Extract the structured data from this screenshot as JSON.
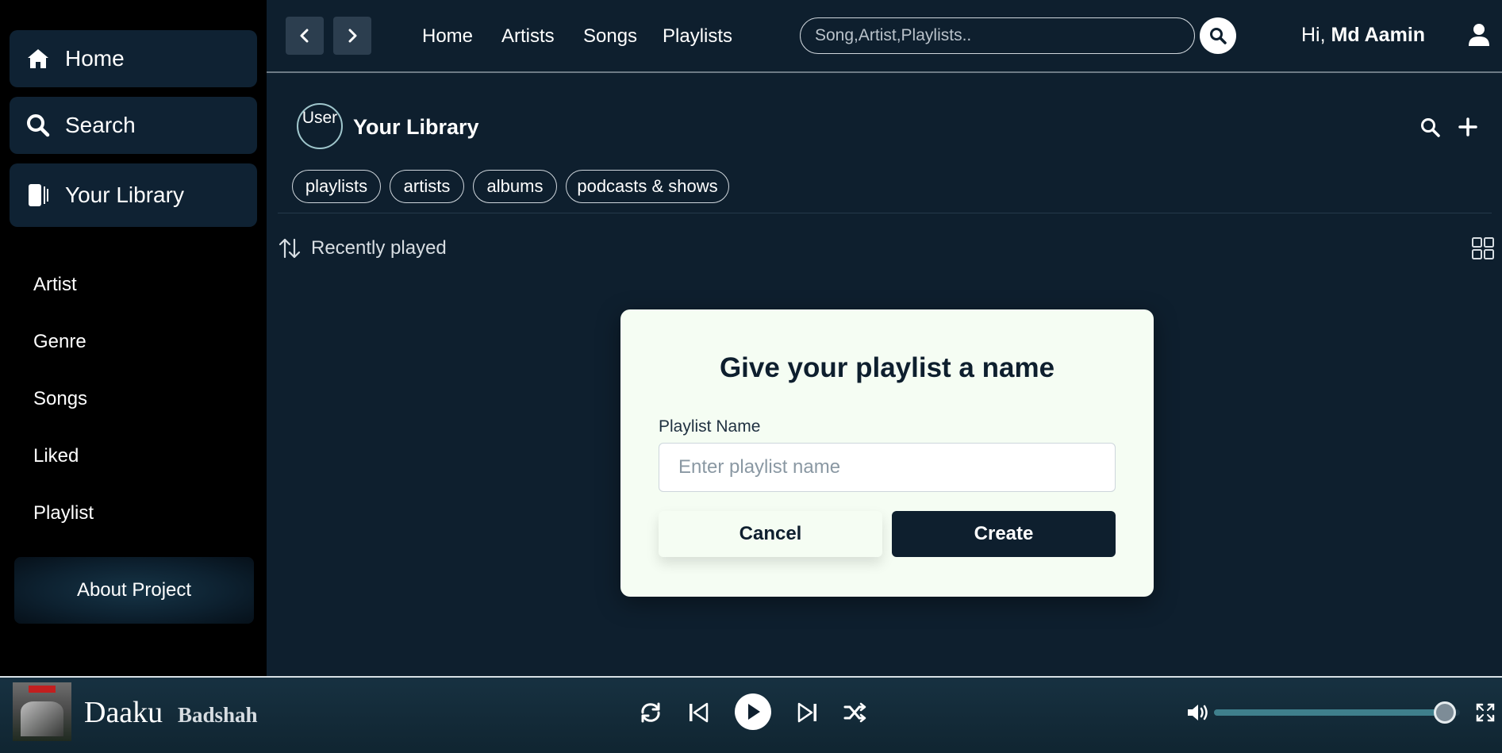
{
  "sidebar": {
    "home_label": "Home",
    "search_label": "Search",
    "library_label": "Your Library",
    "links": [
      "Artist",
      "Genre",
      "Songs",
      "Liked",
      "Playlist"
    ],
    "about_label": "About Project"
  },
  "topnav": {
    "links": [
      "Home",
      "Artists",
      "Songs",
      "Playlists"
    ],
    "search_placeholder": "Song,Artist,Playlists..",
    "greeting": "Hi,",
    "username": "Md Aamin"
  },
  "library": {
    "avatar_text": "User",
    "title": "Your Library",
    "chips": [
      "playlists",
      "artists",
      "albums",
      "podcasts & shows"
    ],
    "sort_label": "Recently played"
  },
  "modal": {
    "title": "Give your playlist a name",
    "field_label": "Playlist Name",
    "field_placeholder": "Enter playlist name",
    "cancel_label": "Cancel",
    "create_label": "Create"
  },
  "player": {
    "song_title": "Daaku",
    "artist": "Badshah",
    "volume_fraction": 0.94
  },
  "colors": {
    "sidebar_bg": "#000000",
    "panel_bg": "#0e1f2e",
    "button_bg": "#0f2233",
    "modal_bg": "#f5fdf3",
    "accent": "#3f7f8c"
  }
}
